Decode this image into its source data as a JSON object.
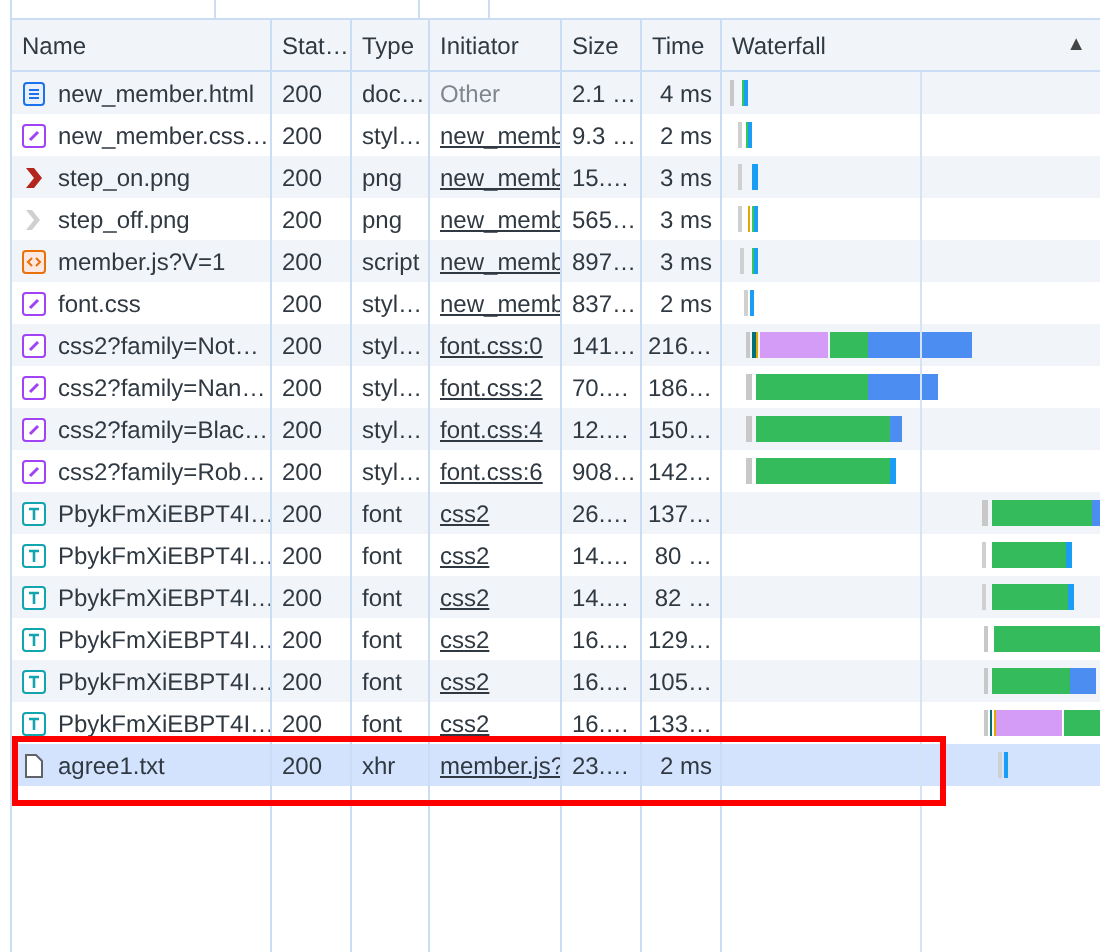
{
  "columns": [
    {
      "label": "Name"
    },
    {
      "label": "Stat…"
    },
    {
      "label": "Type"
    },
    {
      "label": "Initiator"
    },
    {
      "label": "Size"
    },
    {
      "label": "Time"
    },
    {
      "label": "Waterfall",
      "sort_indicator": "▲"
    }
  ],
  "rows": [
    {
      "kind": "document",
      "name": "new_member.html",
      "status": "200",
      "type": "doc…",
      "initiator": "Other",
      "initiator_link": false,
      "size": "2.1 …",
      "time": "4 ms",
      "selected": false,
      "highlighted": false
    },
    {
      "kind": "stylesheet",
      "name": "new_member.css…",
      "status": "200",
      "type": "styl…",
      "initiator": "new_memb",
      "initiator_link": true,
      "size": "9.3 …",
      "time": "2 ms",
      "selected": false,
      "highlighted": false
    },
    {
      "kind": "image_on",
      "name": "step_on.png",
      "status": "200",
      "type": "png",
      "initiator": "new_memb",
      "initiator_link": true,
      "size": "15.…",
      "time": "3 ms",
      "selected": false,
      "highlighted": false
    },
    {
      "kind": "image_off",
      "name": "step_off.png",
      "status": "200",
      "type": "png",
      "initiator": "new_memb",
      "initiator_link": true,
      "size": "565…",
      "time": "3 ms",
      "selected": false,
      "highlighted": false
    },
    {
      "kind": "script",
      "name": "member.js?V=1",
      "status": "200",
      "type": "script",
      "initiator": "new_memb",
      "initiator_link": true,
      "size": "897…",
      "time": "3 ms",
      "selected": false,
      "highlighted": false
    },
    {
      "kind": "stylesheet",
      "name": "font.css",
      "status": "200",
      "type": "styl…",
      "initiator": "new_memb",
      "initiator_link": true,
      "size": "837…",
      "time": "2 ms",
      "selected": false,
      "highlighted": false
    },
    {
      "kind": "stylesheet",
      "name": "css2?family=Not…",
      "status": "200",
      "type": "styl…",
      "initiator": "font.css:0",
      "initiator_link": true,
      "size": "141…",
      "time": "216…",
      "selected": false,
      "highlighted": false
    },
    {
      "kind": "stylesheet",
      "name": "css2?family=Nan…",
      "status": "200",
      "type": "styl…",
      "initiator": "font.css:2",
      "initiator_link": true,
      "size": "70.…",
      "time": "186…",
      "selected": false,
      "highlighted": false
    },
    {
      "kind": "stylesheet",
      "name": "css2?family=Blac…",
      "status": "200",
      "type": "styl…",
      "initiator": "font.css:4",
      "initiator_link": true,
      "size": "12.…",
      "time": "150…",
      "selected": false,
      "highlighted": false
    },
    {
      "kind": "stylesheet",
      "name": "css2?family=Rob…",
      "status": "200",
      "type": "styl…",
      "initiator": "font.css:6",
      "initiator_link": true,
      "size": "908…",
      "time": "142…",
      "selected": false,
      "highlighted": false
    },
    {
      "kind": "font",
      "name": "PbykFmXiEBPT4I…",
      "status": "200",
      "type": "font",
      "initiator": "css2",
      "initiator_link": true,
      "size": "26.…",
      "time": "137…",
      "selected": false,
      "highlighted": false
    },
    {
      "kind": "font",
      "name": "PbykFmXiEBPT4I…",
      "status": "200",
      "type": "font",
      "initiator": "css2",
      "initiator_link": true,
      "size": "14.…",
      "time": "80 …",
      "selected": false,
      "highlighted": false
    },
    {
      "kind": "font",
      "name": "PbykFmXiEBPT4I…",
      "status": "200",
      "type": "font",
      "initiator": "css2",
      "initiator_link": true,
      "size": "14.…",
      "time": "82 …",
      "selected": false,
      "highlighted": false
    },
    {
      "kind": "font",
      "name": "PbykFmXiEBPT4I…",
      "status": "200",
      "type": "font",
      "initiator": "css2",
      "initiator_link": true,
      "size": "16.…",
      "time": "129…",
      "selected": false,
      "highlighted": false
    },
    {
      "kind": "font",
      "name": "PbykFmXiEBPT4I…",
      "status": "200",
      "type": "font",
      "initiator": "css2",
      "initiator_link": true,
      "size": "16.…",
      "time": "105…",
      "selected": false,
      "highlighted": false
    },
    {
      "kind": "font",
      "name": "PbykFmXiEBPT4I…",
      "status": "200",
      "type": "font",
      "initiator": "css2",
      "initiator_link": true,
      "size": "16.…",
      "time": "133…",
      "selected": false,
      "highlighted": false
    },
    {
      "kind": "file",
      "name": "agree1.txt",
      "status": "200",
      "type": "xhr",
      "initiator": "member.js?",
      "initiator_link": true,
      "size": "23.…",
      "time": "2 ms",
      "selected": true,
      "highlighted": true
    }
  ]
}
